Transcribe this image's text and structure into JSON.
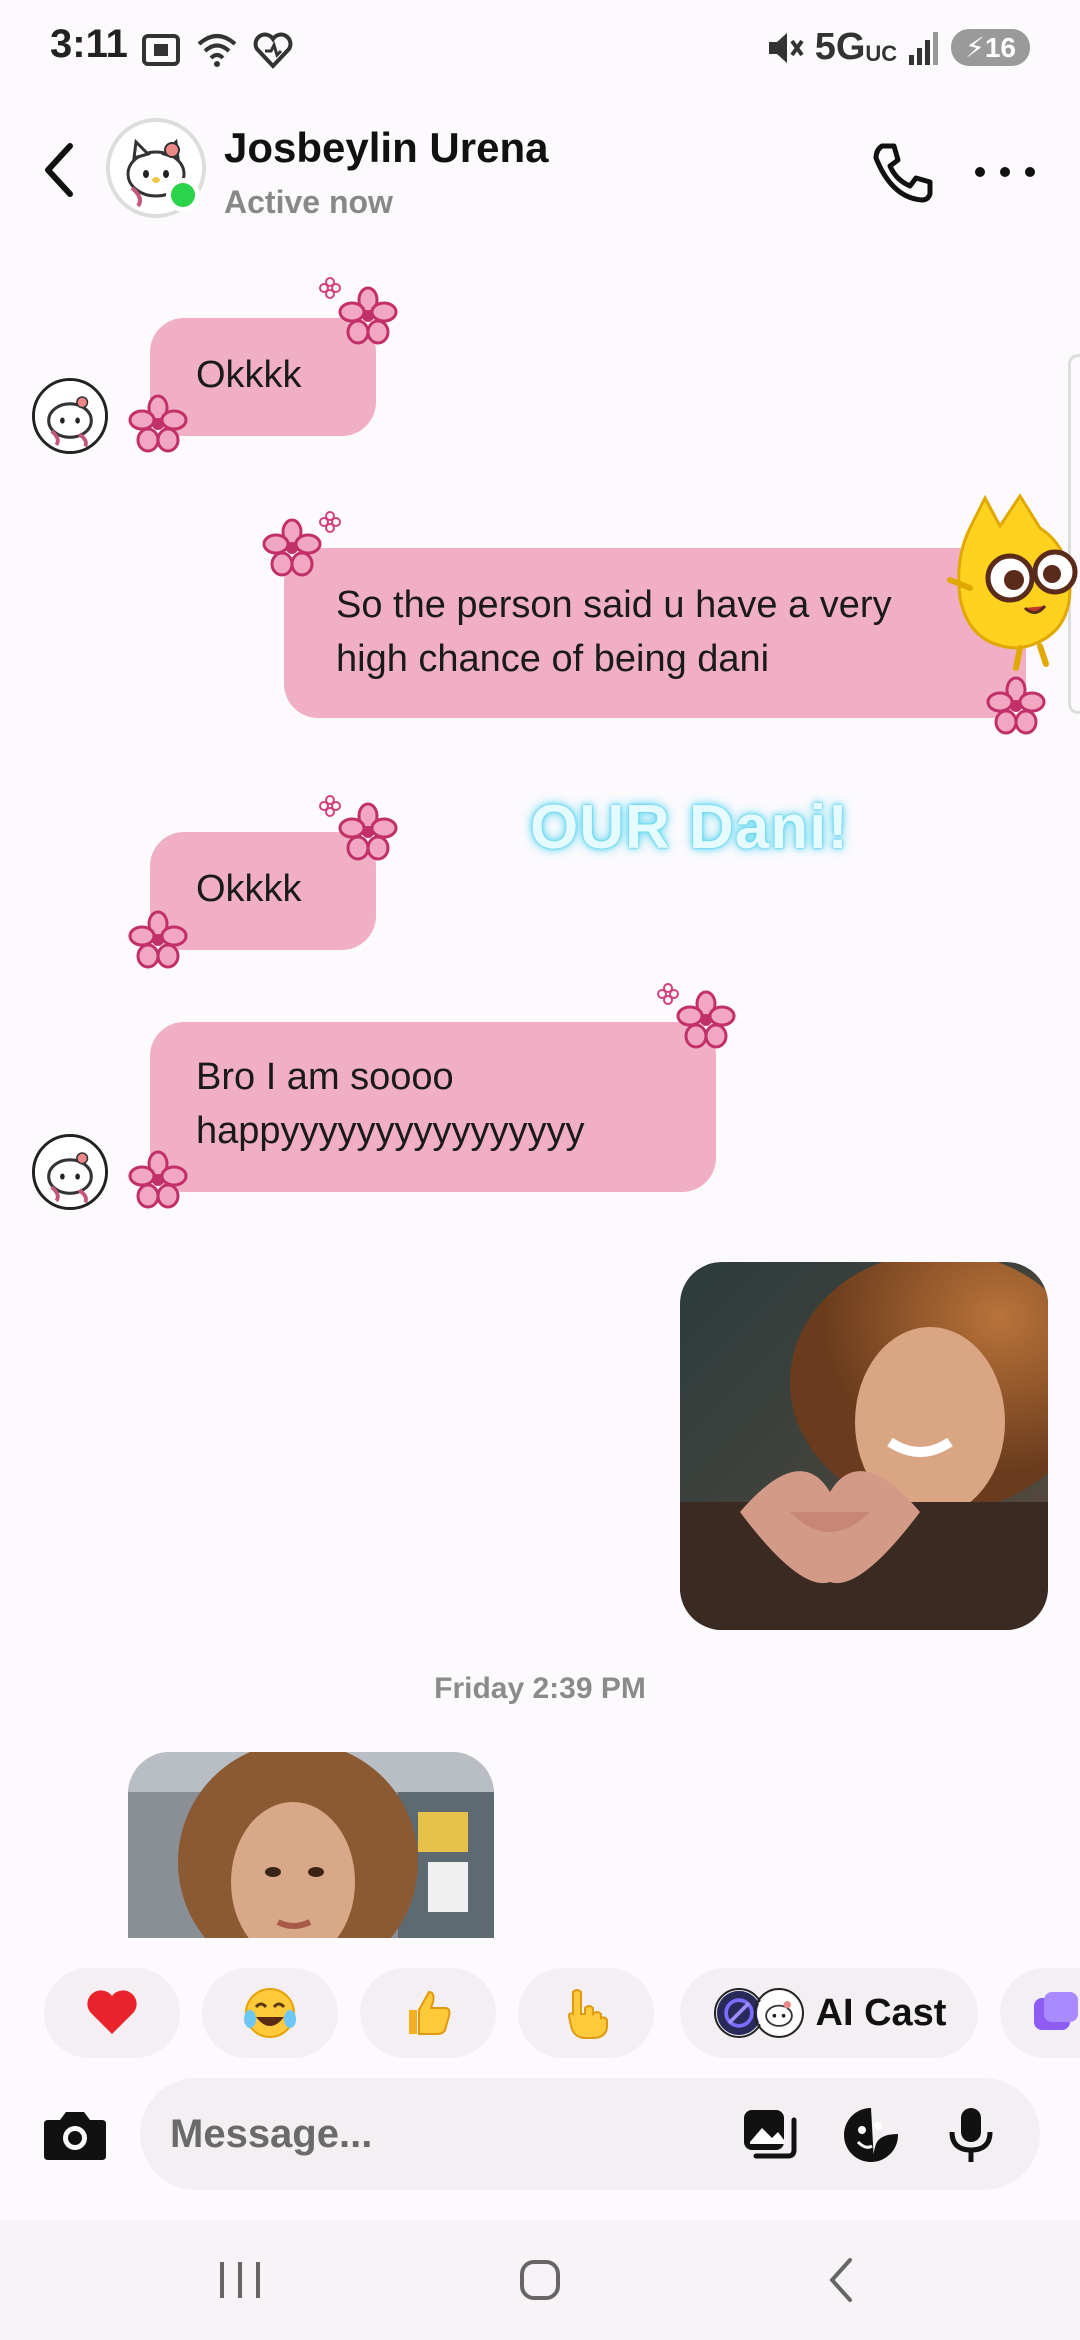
{
  "status_bar": {
    "time": "3:11",
    "network": "5G",
    "network_sub": "UC",
    "battery": "16"
  },
  "header": {
    "contact_name": "Josbeylin Urena",
    "status": "Active now"
  },
  "messages": [
    {
      "side": "incoming",
      "text": "Okkkk"
    },
    {
      "side": "outgoing",
      "text_line1": "So the person said u have a very",
      "text_line2": "high chance of being dani"
    },
    {
      "side": "incoming",
      "text": "Okkkk"
    },
    {
      "side": "incoming",
      "text_line1": "Bro I am soooo",
      "text_line2": "happyyyyyyyyyyyyyyyy"
    }
  ],
  "effect_text": "OUR Dani!",
  "timestamp": "Friday 2:39 PM",
  "quick_reactions": {
    "ai_cast_label": "AI Cast"
  },
  "composer": {
    "placeholder": "Message..."
  },
  "colors": {
    "bubble": "#f1afc5",
    "online": "#2ad34a",
    "effect_glow": "#5fd8f2",
    "accent_purple": "#8c5cf5"
  }
}
